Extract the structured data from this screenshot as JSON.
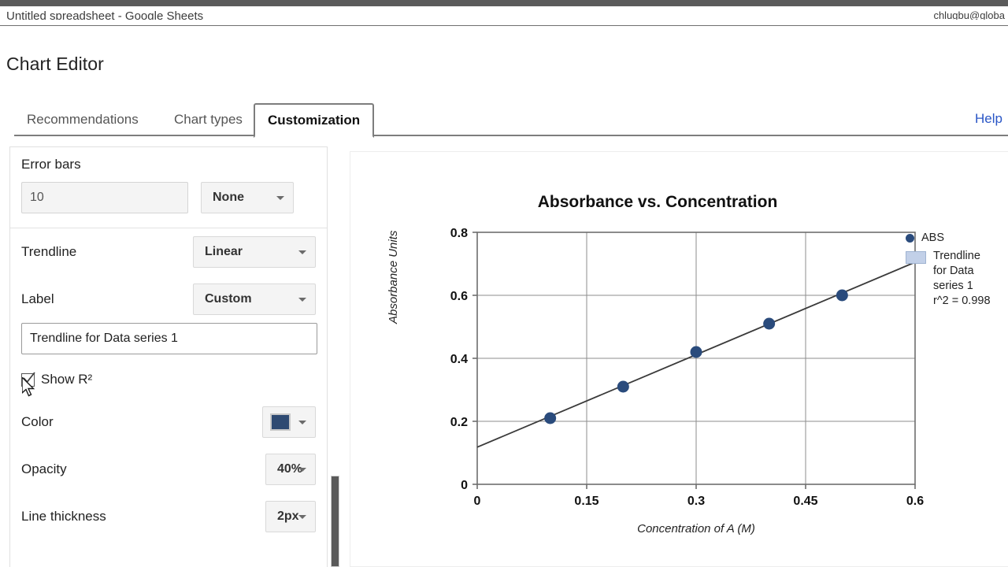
{
  "chrome": {
    "clipped_title": "Untitled spreadsheet - Google Sheets",
    "clipped_account": "chlugbu@globa"
  },
  "dialog": {
    "title": "Chart Editor",
    "help_label": "Help"
  },
  "tabs": [
    {
      "label": "Recommendations",
      "active": false
    },
    {
      "label": "Chart types",
      "active": false
    },
    {
      "label": "Customization",
      "active": true
    }
  ],
  "settings": {
    "error_bars": {
      "label": "Error bars",
      "value": "10",
      "placeholder": "10",
      "type_value": "None"
    },
    "trendline": {
      "label": "Trendline",
      "value": "Linear"
    },
    "label_select": {
      "label": "Label",
      "value": "Custom"
    },
    "label_text": {
      "value": "Trendline for Data series 1"
    },
    "show_r2": {
      "label": "Show R²",
      "checked": true
    },
    "color": {
      "label": "Color",
      "value": "#2e4a72"
    },
    "opacity": {
      "label": "Opacity",
      "value": "40%"
    },
    "line_thickness": {
      "label": "Line thickness",
      "value": "2px"
    }
  },
  "chart_data": {
    "type": "scatter",
    "title": "Absorbance vs. Concentration",
    "xlabel": "Concentration of A (M)",
    "ylabel": "Absorbance Units",
    "xlim": [
      0,
      0.6
    ],
    "ylim": [
      0,
      0.8
    ],
    "xticks": [
      "0",
      "0.15",
      "0.3",
      "0.45",
      "0.6"
    ],
    "xtick_values": [
      0,
      0.15,
      0.3,
      0.45,
      0.6
    ],
    "yticks": [
      "0",
      "0.2",
      "0.4",
      "0.6",
      "0.8"
    ],
    "ytick_values": [
      0,
      0.2,
      0.4,
      0.6,
      0.8
    ],
    "grid": true,
    "legend_position": "right",
    "series": [
      {
        "name": "ABS",
        "type": "scatter",
        "color": "#2a4b7c",
        "x": [
          0.1,
          0.2,
          0.3,
          0.4,
          0.5
        ],
        "y": [
          0.21,
          0.31,
          0.42,
          0.51,
          0.6
        ]
      },
      {
        "name": "Trendline for Data series 1",
        "type": "line",
        "color": "#3a3a3a",
        "annotation": "r^2 = 0.998",
        "x": [
          0,
          0.6
        ],
        "y": [
          0.118,
          0.705
        ]
      }
    ],
    "legend": [
      {
        "marker": "dot",
        "text": "ABS"
      },
      {
        "marker": "swatch",
        "text": "Trendline\nfor Data\nseries 1\nr^2 = 0.998"
      }
    ]
  }
}
